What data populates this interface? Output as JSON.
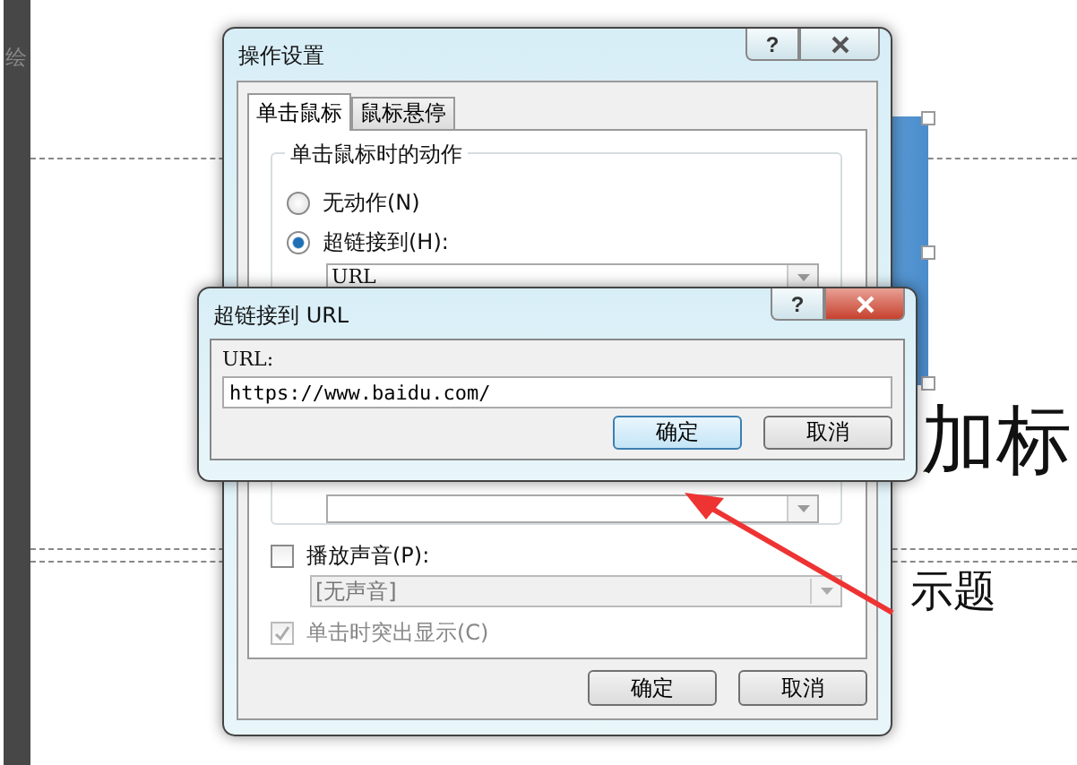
{
  "slide": {
    "corner_text": "绘",
    "title_fragment": "加标",
    "subtitle_fragment": "示题"
  },
  "action_dialog": {
    "title": "操作设置",
    "help": "?",
    "tabs": [
      {
        "label": "单击鼠标",
        "selected": true
      },
      {
        "label": "鼠标悬停",
        "selected": false
      }
    ],
    "group_title": "单击鼠标时的动作",
    "options": [
      {
        "label": "无动作(N)",
        "selected": false
      },
      {
        "label": "超链接到(H):",
        "selected": true
      }
    ],
    "hyperlink_value": "URL",
    "play_sound": {
      "label": "播放声音(P):",
      "checked": false
    },
    "sound_combo": {
      "value": "[无声音]",
      "disabled": true
    },
    "highlight": {
      "label": "单击时突出显示(C)",
      "checked": true,
      "disabled": true
    },
    "buttons": [
      {
        "label": "确定"
      },
      {
        "label": "取消"
      }
    ]
  },
  "url_dialog": {
    "title": "超链接到 URL",
    "help": "?",
    "field_label": "URL:",
    "value": "https://www.baidu.com/",
    "buttons": [
      {
        "label": "确定",
        "default": true
      },
      {
        "label": "取消",
        "default": false
      }
    ]
  }
}
